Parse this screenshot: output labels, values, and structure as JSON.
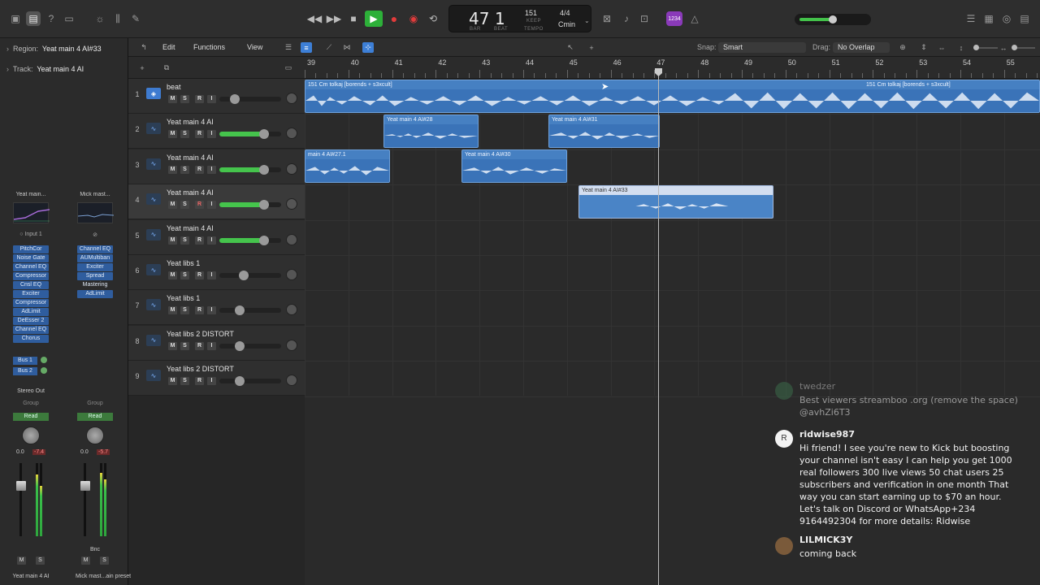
{
  "control_bar": {
    "lcd": {
      "bar": "47",
      "beat": "1",
      "bar_label": "BAR",
      "beat_label": "BEAT",
      "tempo": "151",
      "tempo_sub": "KEEP",
      "tempo_label": "TEMPO",
      "time_sig": "4/4",
      "key": "Cmin"
    },
    "count_in_badge": "1234"
  },
  "inspector": {
    "region_label": "Region:",
    "region_value": "Yeat main 4 AI#33",
    "track_label": "Track:",
    "track_value": "Yeat main 4 AI",
    "strips": [
      {
        "name": "Yeat main...",
        "input": "Input 1",
        "plugins": [
          "PitchCor",
          "Noise Gate",
          "Channel EQ",
          "Compressor",
          "Cnsl EQ",
          "Exciter",
          "Compressor",
          "AdLimit",
          "DeEsser 2",
          "Channel EQ",
          "Chorus"
        ],
        "sends": [
          "Bus 1",
          "Bus 2"
        ],
        "output": "Stereo Out",
        "group": "Group",
        "automation": "Read",
        "vol_left": "0.0",
        "vol_right": "-7.4",
        "mute": "M",
        "solo": "S",
        "footer": "Yeat main 4 AI"
      },
      {
        "name": "Mick mast...",
        "plugins": [
          "Channel EQ",
          "AUMultiban",
          "Exciter",
          "Spread",
          "Mastering",
          "AdLimit"
        ],
        "group": "Group",
        "automation": "Read",
        "vol_left": "0.0",
        "vol_right": "-5.7",
        "bounce": "Bnc",
        "mute": "M",
        "solo": "S",
        "footer": "Mick mast...ain preset"
      }
    ]
  },
  "track_toolbar": {
    "edit": "Edit",
    "functions": "Functions",
    "view": "View",
    "snap_label": "Snap:",
    "snap_value": "Smart",
    "drag_label": "Drag:",
    "drag_value": "No Overlap"
  },
  "ruler": [
    "39",
    "40",
    "41",
    "42",
    "43",
    "44",
    "45",
    "46",
    "47",
    "48",
    "49",
    "50",
    "51",
    "52",
    "53",
    "54",
    "55"
  ],
  "tracks": [
    {
      "num": "1",
      "name": "beat",
      "vol": 0.25,
      "type": "beat"
    },
    {
      "num": "2",
      "name": "Yeat main 4 AI",
      "vol": 0.72
    },
    {
      "num": "3",
      "name": "Yeat main 4 AI",
      "vol": 0.72
    },
    {
      "num": "4",
      "name": "Yeat main 4 AI",
      "vol": 0.72
    },
    {
      "num": "5",
      "name": "Yeat main 4 AI",
      "vol": 0.72
    },
    {
      "num": "6",
      "name": "Yeat libs 1",
      "vol": 0.4
    },
    {
      "num": "7",
      "name": "Yeat libs 1",
      "vol": 0.33
    },
    {
      "num": "8",
      "name": "Yeat libs 2 DISTORT",
      "vol": 0.33
    },
    {
      "num": "9",
      "name": "Yeat libs 2 DISTORT",
      "vol": 0.33
    }
  ],
  "track_buttons": {
    "m": "M",
    "s": "S",
    "r": "R",
    "i": "I"
  },
  "regions": {
    "beat_a": "151 Cm tolkaj [borends + s3xcult]",
    "beat_b": "151 Cm tolkaj [borends + s3xcult]",
    "r28": "Yeat main 4 AI#28",
    "r31": "Yeat main 4 AI#31",
    "r27": "main 4 AI#27.1",
    "r30": "Yeat main 4 AI#30",
    "r33": "Yeat main 4 AI#33"
  },
  "chat": [
    {
      "user": "twedzer",
      "text": "Best viewers streamboo .org (remove the space) @avhZi6T3"
    },
    {
      "user": "ridwise987",
      "text": "Hi friend! I see you're new to Kick but boosting your channel isn't easy I can help you get 1000 real followers 300 live views 50 chat users 25 subscribers and verification in one month That way you can start earning up to $70 an hour. Let's talk on Discord or WhatsApp+234 9164492304 for more details: Ridwise",
      "avatar_letter": "R"
    },
    {
      "user": "LILMICK3Y",
      "text": "coming back"
    }
  ],
  "colors": {
    "region_blue": "#4680c2",
    "region_selected": "#d3def0",
    "play_green": "#2db039",
    "record_red": "#e23b3b",
    "count_in_purple": "#8a3ab9"
  }
}
